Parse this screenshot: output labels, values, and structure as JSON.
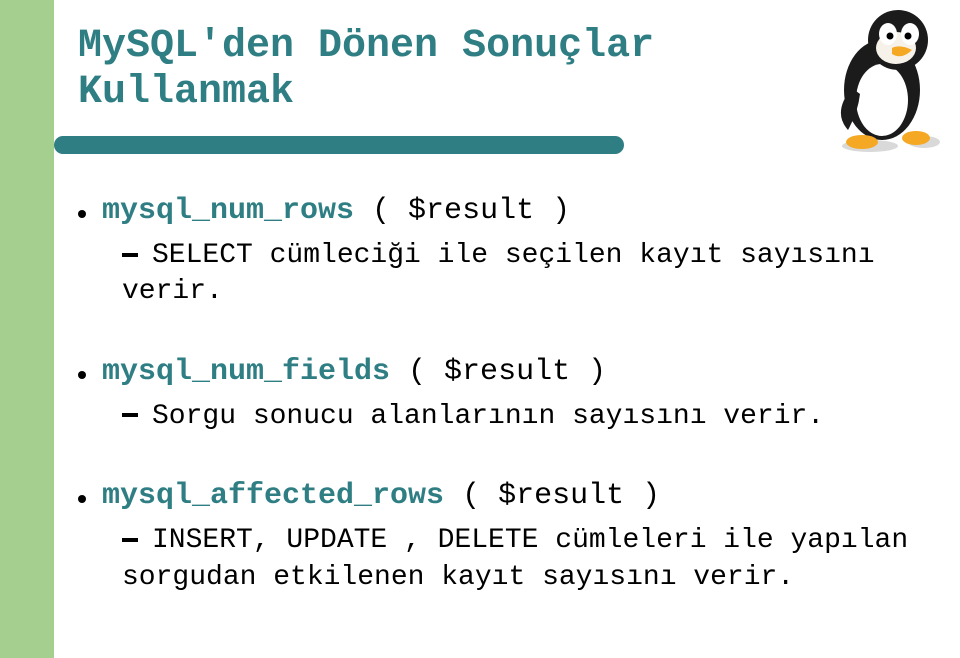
{
  "title_line1": "MySQL'den Dönen Sonuçlar",
  "title_line2": "Kullanmak",
  "items": [
    {
      "code": "mysql_num_rows",
      "args": " ( $result )",
      "desc": "SELECT cümleciği ile seçilen kayıt sayısını verir."
    },
    {
      "code": "mysql_num_fields",
      "args": " ( $result )",
      "desc": "Sorgu sonucu alanlarının sayısını verir."
    },
    {
      "code": "mysql_affected_rows",
      "args": " ( $result )",
      "desc": "INSERT, UPDATE , DELETE cümleleri ile yapılan sorgudan etkilenen kayıt sayısını verir."
    }
  ]
}
